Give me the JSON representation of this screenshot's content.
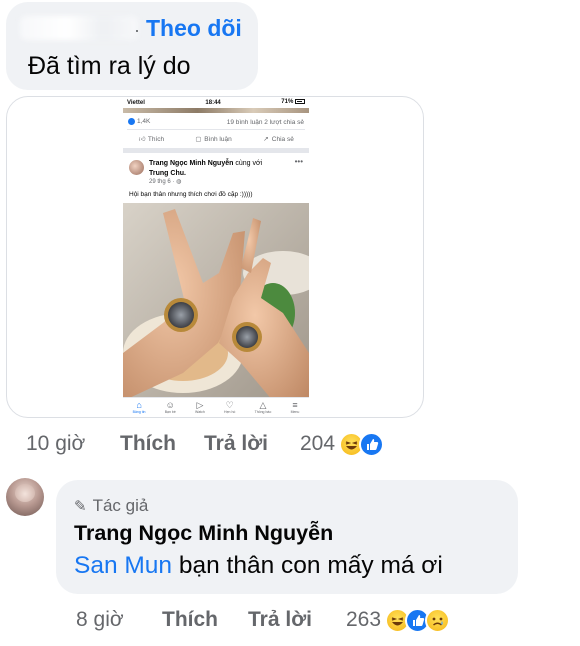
{
  "comment1": {
    "follow_label": "Theo dõi",
    "text": "Đã tìm ra lý do",
    "attachment": {
      "status": {
        "carrier": "Viettel",
        "time": "18:44",
        "battery": "71%"
      },
      "counts": {
        "reactions": "1,4K",
        "comments_shares": "19 bình luận   2 lượt chia sẻ"
      },
      "actions": {
        "like": "Thích",
        "comment": "Bình luận",
        "share": "Chia sẻ"
      },
      "post": {
        "author": "Trang Ngọc Minh Nguyễn",
        "with_word": "cùng với",
        "tagged": "Trung Chu.",
        "date": "29 thg 6 · ",
        "caption": "Hội bạn thân nhưng thích chơi đồ cặp :)))))"
      },
      "tabs": [
        "Bảng tin",
        "Bạn bè",
        "Watch",
        "Hẹn hò",
        "Thông báo",
        "Menu"
      ]
    },
    "time": "10 giờ",
    "like_label": "Thích",
    "reply_label": "Trả lời",
    "reaction_count": "204",
    "reactions": [
      "haha",
      "like"
    ]
  },
  "comment2": {
    "author_badge": "Tác giả",
    "author": "Trang Ngọc Minh Nguyễn",
    "mention": "San Mun",
    "text": " bạn thân con mấy má ơi",
    "time": "8 giờ",
    "like_label": "Thích",
    "reply_label": "Trả lời",
    "reaction_count": "263",
    "reactions": [
      "haha",
      "like",
      "sad"
    ]
  },
  "colors": {
    "accent": "#1877f2",
    "bubble": "#f0f2f5",
    "muted": "#65676b"
  }
}
